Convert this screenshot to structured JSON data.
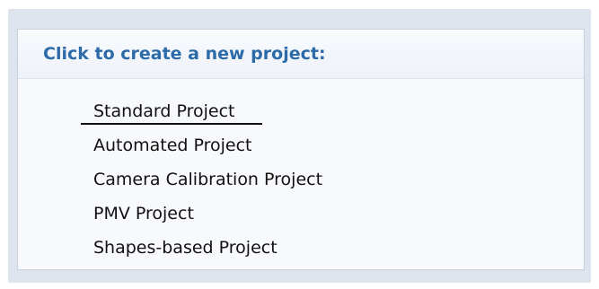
{
  "panel": {
    "title": "Click to create a new project:"
  },
  "projects": [
    {
      "label": "Standard Project"
    },
    {
      "label": "Automated Project"
    },
    {
      "label": "Camera Calibration Project"
    },
    {
      "label": "PMV Project"
    },
    {
      "label": "Shapes-based Project"
    }
  ],
  "colors": {
    "title": "#2c6aa8",
    "frame": "#dde4ee",
    "panel": "#f7f9fc"
  }
}
